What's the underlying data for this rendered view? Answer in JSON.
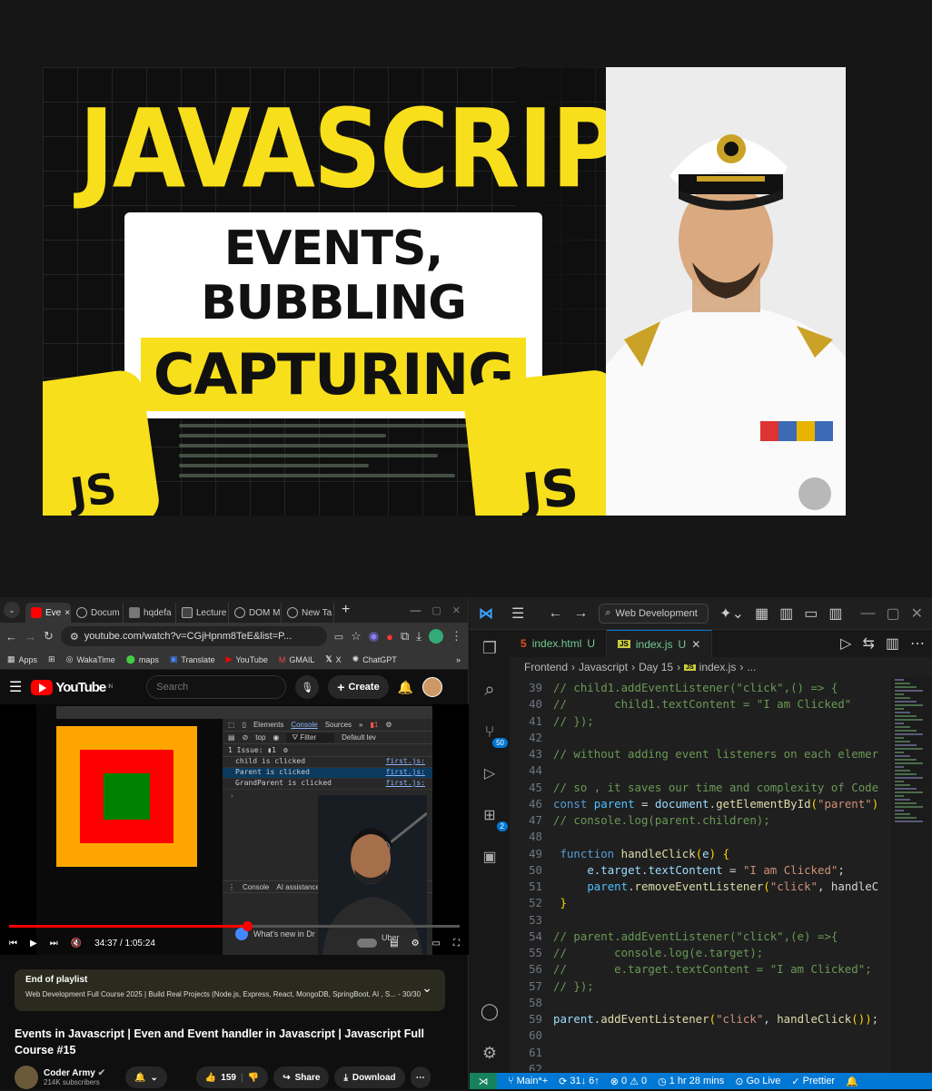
{
  "thumbnail": {
    "title": "JAVASCRIPT",
    "subtitle": "EVENTS, BUBBLING",
    "highlight": "CAPTURING",
    "logo_text": "JS",
    "accent": "#f8df1b"
  },
  "browser": {
    "tabs": [
      "Eve",
      "Docum",
      "hqdefa",
      "Lecture",
      "DOM M",
      "New Ta"
    ],
    "url": "youtube.com/watch?v=CGjHpnm8TeE&list=P...",
    "bookmarks": [
      "Apps",
      "WakaTime",
      "maps",
      "Translate",
      "YouTube",
      "GMAIL",
      "X",
      "ChatGPT"
    ],
    "yt": {
      "logo": "YouTube",
      "region": "IN",
      "search_placeholder": "Search",
      "create": "Create"
    },
    "devtools": {
      "tabs": [
        "Elements",
        "Console",
        "Sources"
      ],
      "context": "top",
      "filter": "Filter",
      "levels": "Default lev",
      "issues": "1 Issue: ▮1",
      "logs": [
        {
          "text": "child is clicked",
          "src": "first.js:"
        },
        {
          "text": "Parent is clicked",
          "src": "first.js:"
        },
        {
          "text": "GrandParent is clicked",
          "src": "first.js:"
        }
      ],
      "drawer_tabs": [
        "Console",
        "AI assistance"
      ],
      "whats_new": "What's new in Dr"
    },
    "player": {
      "time": "34:37 / 1:05:24",
      "progress": 0.529,
      "watermark": "Uber"
    },
    "playlist": {
      "label": "End of playlist",
      "name": "Web Development Full Course 2025 | Build Real Projects (Node.js, Express, React, MongoDB, SpringBoot, AI , S... - 30/30"
    },
    "video_title": "Events in Javascript | Even and Event handler in Javascript | Javascript Full Course #15",
    "channel": {
      "name": "Coder Army",
      "subscribers": "214K subscribers",
      "likes": "159",
      "share": "Share",
      "download": "Download"
    }
  },
  "vscode": {
    "search": "Web Development",
    "tabs": [
      {
        "name": "index.html",
        "status": "U"
      },
      {
        "name": "index.js",
        "status": "U"
      }
    ],
    "breadcrumbs": [
      "Frontend",
      "Javascript",
      "Day 15",
      "index.js",
      "..."
    ],
    "badges": {
      "source_control": "50",
      "extensions": "2"
    },
    "code": [
      {
        "n": "39",
        "html": "<span class='cm'>// child1.addEventListener(\"click\",() =&gt; {</span>"
      },
      {
        "n": "40",
        "html": "<span class='cm'>//       child1.textContent = \"I am Clicked\"</span>"
      },
      {
        "n": "41",
        "html": "<span class='cm'>// });</span>"
      },
      {
        "n": "42",
        "html": ""
      },
      {
        "n": "43",
        "html": "<span class='cm'>// without adding event listeners on each elemer</span>"
      },
      {
        "n": "44",
        "html": ""
      },
      {
        "n": "45",
        "html": "<span class='cm'>// so , it saves our time and complexity of Code</span>"
      },
      {
        "n": "46",
        "html": "<span class='kw'>const</span> <span class='cn'>parent</span> <span class='pl'>= </span><span class='vr'>document</span><span class='pl'>.</span><span class='fn'>getElementById</span><span class='br'>(</span><span class='st'>\"parent\"</span><span class='br'>)</span>"
      },
      {
        "n": "47",
        "html": "<span class='cm'>// console.log(parent.children);</span>"
      },
      {
        "n": "48",
        "html": ""
      },
      {
        "n": "49",
        "html": " <span class='kw'>function</span> <span class='fn'>handleClick</span><span class='br'>(</span><span class='vr'>e</span><span class='br'>)</span> <span class='br'>{</span>"
      },
      {
        "n": "50",
        "html": "     <span class='vr'>e</span><span class='pl'>.</span><span class='vr'>target</span><span class='pl'>.</span><span class='vr'>textContent</span> <span class='pl'>=</span> <span class='st'>\"I am Clicked\"</span><span class='pl'>;</span>"
      },
      {
        "n": "51",
        "html": "     <span class='cn'>parent</span><span class='pl'>.</span><span class='fn'>removeEventListener</span><span class='br'>(</span><span class='st'>\"click\"</span><span class='pl'>, handleC</span>"
      },
      {
        "n": "52",
        "html": " <span class='br'>}</span>"
      },
      {
        "n": "53",
        "html": ""
      },
      {
        "n": "54",
        "html": "<span class='cm'>// parent.addEventListener(\"click\",(e) =&gt;{</span>"
      },
      {
        "n": "55",
        "html": "<span class='cm'>//       console.log(e.target);</span>"
      },
      {
        "n": "56",
        "html": "<span class='cm'>//       e.target.textContent = \"I am Clicked\";</span>"
      },
      {
        "n": "57",
        "html": "<span class='cm'>// });</span>"
      },
      {
        "n": "58",
        "html": ""
      },
      {
        "n": "59",
        "html": "<span class='vr'>parent</span><span class='pl'>.</span><span class='fn'>addEventListener</span><span class='br'>(</span><span class='st'>\"click\"</span><span class='pl'>, </span><span class='fn'>handleClick</span><span class='br'>()</span><span class='br'>)</span><span class='pl'>;</span>"
      },
      {
        "n": "60",
        "html": ""
      },
      {
        "n": "61",
        "html": ""
      },
      {
        "n": "62",
        "html": ""
      }
    ],
    "status": {
      "branch": "Main*+",
      "sync": "31↓ 6↑",
      "errors": "0",
      "warnings": "0",
      "time": "1 hr 28 mins",
      "golive": "Go Live",
      "prettier": "Prettier"
    }
  }
}
